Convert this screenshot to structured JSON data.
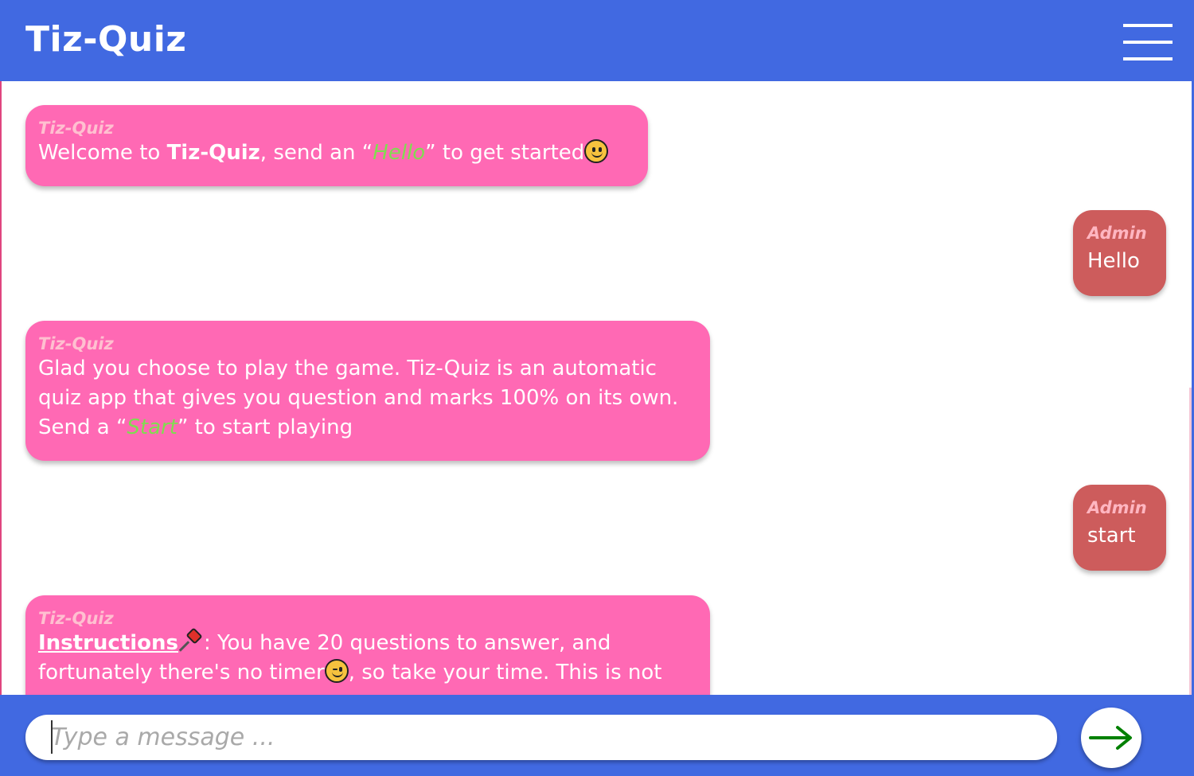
{
  "header": {
    "title": "Tiz-Quiz",
    "menu_icon": "hamburger-menu-icon"
  },
  "messages": [
    {
      "sender": "Tiz-Quiz",
      "pre": "Welcome to ",
      "bold": "Tiz-Quiz",
      "mid": ", send an “",
      "highlight": "Hello",
      "post": "” to get started"
    },
    {
      "sender": "Admin",
      "text": "Hello"
    },
    {
      "sender": "Tiz-Quiz",
      "pre": "Glad you choose to play the game. Tiz-Quiz is an automatic quiz app that gives you question and marks 100% on its own. Send a “",
      "highlight": "Start",
      "post": "” to start playing"
    },
    {
      "sender": "Admin",
      "text": "start"
    },
    {
      "sender": "Tiz-Quiz",
      "title": "Instructions",
      "text1": ": You have 20 questions to answer, and fortunately there's no timer",
      "text2": ", so take your time. This is not"
    }
  ],
  "composer": {
    "placeholder": "Type a message ...",
    "send_icon": "arrow-right-icon"
  },
  "colors": {
    "primary": "#4169e1",
    "bot_bubble": "#ff69b4",
    "user_bubble": "#cd5c5c",
    "highlight": "#7fdd50",
    "send_arrow": "#008000"
  }
}
